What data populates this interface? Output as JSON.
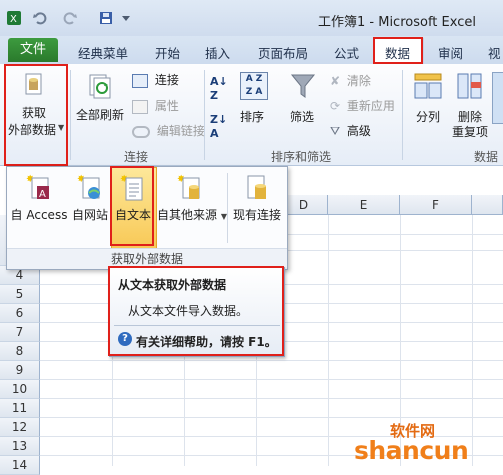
{
  "window": {
    "title": "工作簿1 - Microsoft Excel"
  },
  "ribbon_tabs": [
    {
      "label": "文件"
    },
    {
      "label": "经典菜单"
    },
    {
      "label": "开始"
    },
    {
      "label": "插入"
    },
    {
      "label": "页面布局"
    },
    {
      "label": "公式"
    },
    {
      "label": "数据"
    },
    {
      "label": "审阅"
    },
    {
      "label": "视"
    }
  ],
  "ribbon": {
    "get_external": {
      "line1": "获取",
      "line2": "外部数据"
    },
    "refresh_all": "全部刷新",
    "connections": "连接",
    "properties": "属性",
    "edit_links": "编辑链接",
    "group_connections": "连接",
    "sort_az": "A↓Z",
    "sort": "排序",
    "filter": "筛选",
    "clear": "清除",
    "reapply": "重新应用",
    "advanced": "高级",
    "group_sort_filter": "排序和筛选",
    "split": "分列",
    "remove_dup_line1": "删除",
    "remove_dup_line2": "重复项",
    "group_data_tools": "数据"
  },
  "dropdown": {
    "items": [
      {
        "label": "自 Access"
      },
      {
        "label": "自网站"
      },
      {
        "label": "自文本"
      },
      {
        "label": "自其他来源"
      },
      {
        "label": "现有连接"
      }
    ],
    "footer": "获取外部数据"
  },
  "grid": {
    "columns": [
      "D",
      "E",
      "F"
    ],
    "rows": [
      "4",
      "5",
      "6",
      "7",
      "8",
      "9",
      "10",
      "11",
      "12",
      "13",
      "14"
    ]
  },
  "tooltip": {
    "title": "从文本获取外部数据",
    "body": "从文本文件导入数据。",
    "help": "有关详细帮助，请按 F1。"
  },
  "watermark": {
    "line1": "软件网",
    "line2": "shancun"
  },
  "colors": {
    "accent_file_tab": "#2a7a2c",
    "highlight": "#e0201a",
    "hover": "#f8c957"
  }
}
